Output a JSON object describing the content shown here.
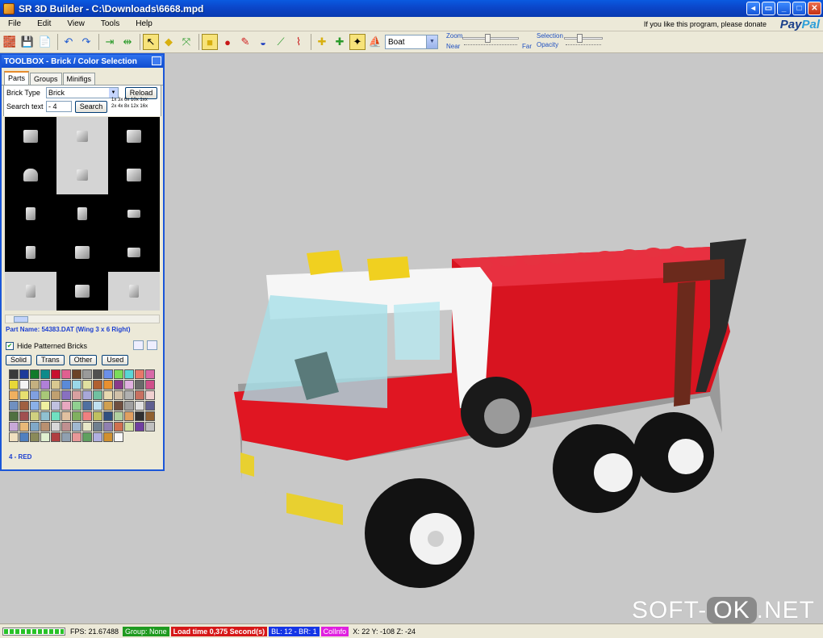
{
  "window": {
    "title": "SR 3D Builder - C:\\Downloads\\6668.mpd"
  },
  "menu": [
    "File",
    "Edit",
    "View",
    "Tools",
    "Help"
  ],
  "donate": {
    "text": "If you like this program, please donate",
    "paypal_a": "Pay",
    "paypal_b": "Pal"
  },
  "toolbar": {
    "model_combo": "Boat",
    "zoom": {
      "label": "Zoom",
      "near": "Near",
      "far": "Far"
    },
    "selection": {
      "label": "Selection",
      "opacity": "Opacity"
    }
  },
  "toolbox": {
    "title": "TOOLBOX - Brick / Color Selection",
    "tabs": [
      "Parts",
      "Groups",
      "Minifigs"
    ],
    "brick_type_label": "Brick Type",
    "brick_type_value": "Brick",
    "reload_label": "Reload",
    "search_label": "Search text",
    "search_value": "- 4",
    "search_button": "Search",
    "size_filters": [
      "1x",
      "3x",
      "6x",
      "10x",
      "1xx",
      "2x",
      "4x",
      "8x",
      "12x",
      "16x"
    ],
    "part_name": "Part Name: 54383.DAT (Wing 3 x 6 Right)",
    "hide_patterned_label": "Hide Patterned Bricks",
    "hide_patterned_checked": true,
    "color_buttons": [
      "Solid",
      "Trans",
      "Other",
      "Used"
    ],
    "selected_color": "4 - RED",
    "palette": [
      "#3a3a3a",
      "#1e3a9a",
      "#117a2a",
      "#0e8a8a",
      "#c8102e",
      "#e06090",
      "#6b4226",
      "#9a9a9a",
      "#505050",
      "#6b8fe8",
      "#7bdc5a",
      "#5ad6d6",
      "#e8786a",
      "#d86aa8",
      "#e8d838",
      "#f4f4f4",
      "#c4b080",
      "#b080d8",
      "#d8c890",
      "#5a8ad8",
      "#9ad8e8",
      "#e0e0a0",
      "#b06030",
      "#e89030",
      "#8a3a8a",
      "#e0b0e0",
      "#6a6a6a",
      "#d0508a",
      "#f0b060",
      "#e8e070",
      "#80a0e0",
      "#a8c878",
      "#c0a070",
      "#8870c0",
      "#d8a0a0",
      "#a8a8d8",
      "#70c0a0",
      "#e8d8b0",
      "#d0c0a8",
      "#b0b0b0",
      "#c87060",
      "#f0d0d0",
      "#7090c0",
      "#a06040",
      "#8ab0e8",
      "#f0f0a0",
      "#c0c0e0",
      "#e8a8c0",
      "#90d090",
      "#5070a0",
      "#c0e0f0",
      "#d0a050",
      "#705040",
      "#a0a0a0",
      "#e0e0e0",
      "#606090",
      "#507040",
      "#a05050",
      "#d0d080",
      "#90c0d0",
      "#70e0c0",
      "#e0c0a0",
      "#80b060",
      "#f08080",
      "#c0c060",
      "#305080",
      "#b0d0a0",
      "#e0a060",
      "#303030",
      "#906030",
      "#c8a8d8",
      "#e8b878",
      "#80a8c8",
      "#b89070",
      "#d8d8d8",
      "#c09090",
      "#a0b8d0",
      "#e8e8c8",
      "#708090",
      "#9080b0",
      "#d07050",
      "#d0e0a0",
      "#7040a0",
      "#c0c0c0",
      "#f0e0c0",
      "#5080c0",
      "#8a8a5a",
      "#e0f0d0",
      "#b04040",
      "#90a0b0",
      "#e89898",
      "#60a060",
      "#b0b0e0",
      "#d09030",
      "#f8f8f8"
    ]
  },
  "status": {
    "progress_fraction": 1.0,
    "fps": "FPS: 21.67488",
    "group": "Group: None",
    "load_time": "Load time 0,375 Second(s)",
    "bl": "BL: 12 - BR: 1",
    "colinfo": "ColInfo",
    "coords": "X: 22  Y: -108  Z: -24"
  },
  "watermark": {
    "pre": "SOFT-",
    "ok": "OK",
    "post": ".NET"
  }
}
